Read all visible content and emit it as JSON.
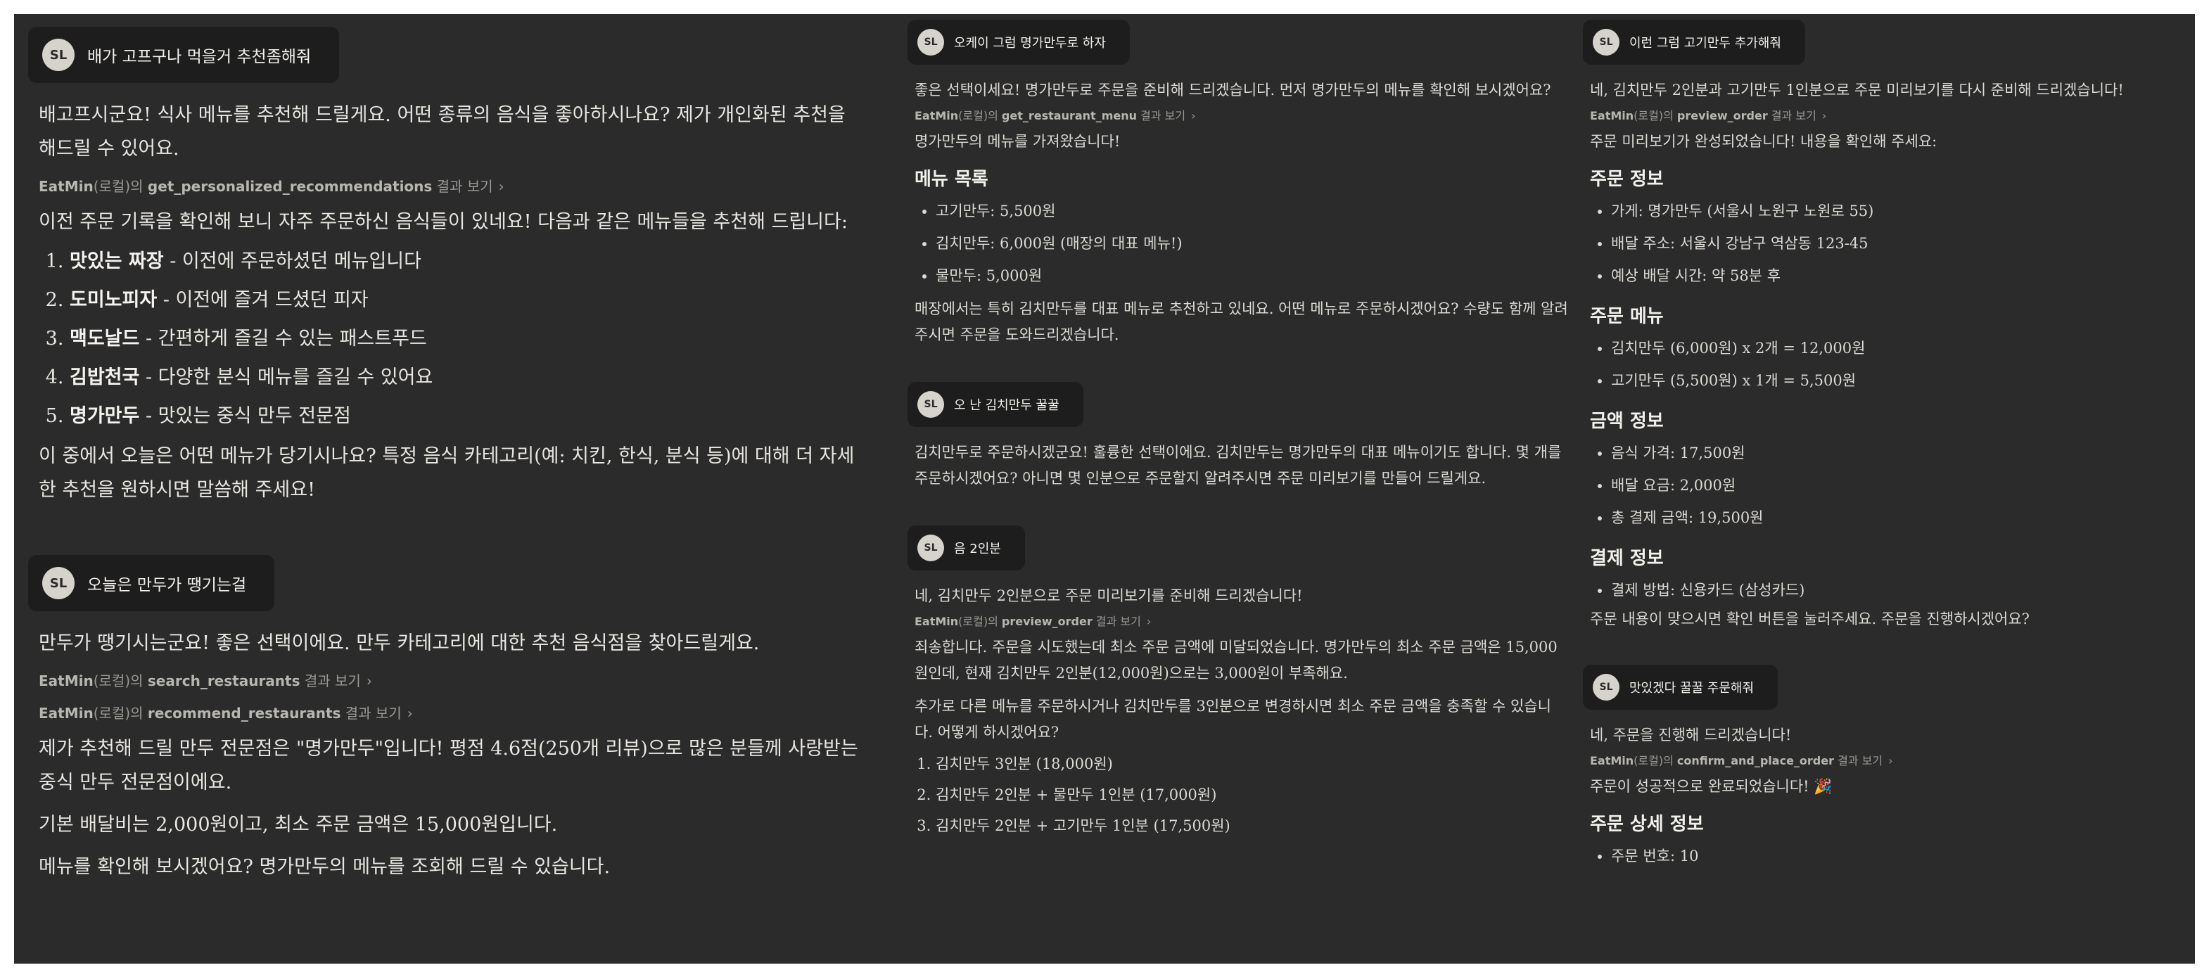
{
  "user_initials": "SL",
  "tool_suffix": "결과 보기",
  "tool_prefix_owner": "EatMin",
  "tool_prefix_local": "(로컬)의",
  "col1": {
    "q1": "배가 고프구나 먹을거 추천좀해줘",
    "a1_p1": "배고프시군요! 식사 메뉴를 추천해 드릴게요. 어떤 종류의 음식을 좋아하시나요? 제가 개인화된 추천을 해드릴 수 있어요.",
    "a1_tool": "get_personalized_recommendations",
    "a1_p2": "이전 주문 기록을 확인해 보니 자주 주문하신 음식들이 있네요! 다음과 같은 메뉴들을 추천해 드립니다:",
    "a1_list": [
      {
        "name": "맛있는 짜장",
        "desc": " - 이전에 주문하셨던 메뉴입니다"
      },
      {
        "name": "도미노피자",
        "desc": " - 이전에 즐겨 드셨던 피자"
      },
      {
        "name": "맥도날드",
        "desc": " - 간편하게 즐길 수 있는 패스트푸드"
      },
      {
        "name": "김밥천국",
        "desc": " - 다양한 분식 메뉴를 즐길 수 있어요"
      },
      {
        "name": "명가만두",
        "desc": " - 맛있는 중식 만두 전문점"
      }
    ],
    "a1_p3": "이 중에서 오늘은 어떤 메뉴가 당기시나요? 특정 음식 카테고리(예: 치킨, 한식, 분식 등)에 대해 더 자세한 추천을 원하시면 말씀해 주세요!",
    "q2": "오늘은 만두가 땡기는걸",
    "a2_p1": "만두가 땡기시는군요! 좋은 선택이에요. 만두 카테고리에 대한 추천 음식점을 찾아드릴게요.",
    "a2_tool1": "search_restaurants",
    "a2_tool2": "recommend_restaurants",
    "a2_p2": "제가 추천해 드릴 만두 전문점은 \"명가만두\"입니다! 평점 4.6점(250개 리뷰)으로 많은 분들께 사랑받는 중식 만두 전문점이에요.",
    "a2_p3": "기본 배달비는 2,000원이고, 최소 주문 금액은 15,000원입니다.",
    "a2_p4": "메뉴를 확인해 보시겠어요? 명가만두의 메뉴를 조회해 드릴 수 있습니다."
  },
  "col2": {
    "q1": "오케이 그럼 명가만두로 하자",
    "a1_p1": "좋은 선택이세요! 명가만두로 주문을 준비해 드리겠습니다. 먼저 명가만두의 메뉴를 확인해 보시겠어요?",
    "a1_tool": "get_restaurant_menu",
    "a1_p2": "명가만두의 메뉴를 가져왔습니다!",
    "menu_heading": "메뉴 목록",
    "menu": [
      "고기만두: 5,500원",
      "김치만두: 6,000원 (매장의 대표 메뉴!)",
      "물만두: 5,000원"
    ],
    "a1_p3": "매장에서는 특히 김치만두를 대표 메뉴로 추천하고 있네요. 어떤 메뉴로 주문하시겠어요? 수량도 함께 알려주시면 주문을 도와드리겠습니다.",
    "q2": "오 난 김치만두 꿀꿀",
    "a2_p1": "김치만두로 주문하시겠군요! 훌륭한 선택이에요. 김치만두는 명가만두의 대표 메뉴이기도 합니다. 몇 개를 주문하시겠어요? 아니면 몇 인분으로 주문할지 알려주시면 주문 미리보기를 만들어 드릴게요.",
    "q3": "음 2인분",
    "a3_p1": "네, 김치만두 2인분으로 주문 미리보기를 준비해 드리겠습니다!",
    "a3_tool": "preview_order",
    "a3_p2": "죄송합니다. 주문을 시도했는데 최소 주문 금액에 미달되었습니다. 명가만두의 최소 주문 금액은 15,000원인데, 현재 김치만두 2인분(12,000원)으로는 3,000원이 부족해요.",
    "a3_p3": "추가로 다른 메뉴를 주문하시거나 김치만두를 3인분으로 변경하시면 최소 주문 금액을 충족할 수 있습니다. 어떻게 하시겠어요?",
    "options": [
      "김치만두 3인분 (18,000원)",
      "김치만두 2인분 + 물만두 1인분 (17,000원)",
      "김치만두 2인분 + 고기만두 1인분 (17,500원)"
    ]
  },
  "col3": {
    "q1": "이런 그럼 고기만두 추가해줘",
    "a1_p1": "네, 김치만두 2인분과 고기만두 1인분으로 주문 미리보기를 다시 준비해 드리겠습니다!",
    "a1_tool": "preview_order",
    "a1_p2": "주문 미리보기가 완성되었습니다! 내용을 확인해 주세요:",
    "h_info": "주문 정보",
    "info": [
      "가게: 명가만두 (서울시 노원구 노원로 55)",
      "배달 주소: 서울시 강남구 역삼동 123-45",
      "예상 배달 시간: 약 58분 후"
    ],
    "h_menu": "주문 메뉴",
    "menu": [
      "김치만두 (6,000원) x 2개 = 12,000원",
      "고기만두 (5,500원) x 1개 = 5,500원"
    ],
    "h_amount": "금액 정보",
    "amount": [
      "음식 가격: 17,500원",
      "배달 요금: 2,000원",
      "총 결제 금액: 19,500원"
    ],
    "h_pay": "결제 정보",
    "pay": [
      "결제 방법: 신용카드 (삼성카드)"
    ],
    "a1_p3": "주문 내용이 맞으시면 확인 버튼을 눌러주세요. 주문을 진행하시겠어요?",
    "q2": "맛있겠다 꿀꿀 주문해줘",
    "a2_p1": "네, 주문을 진행해 드리겠습니다!",
    "a2_tool": "confirm_and_place_order",
    "a2_p2": "주문이 성공적으로 완료되었습니다! 🎉",
    "h_detail": "주문 상세 정보",
    "detail": [
      "주문 번호: 10"
    ]
  }
}
